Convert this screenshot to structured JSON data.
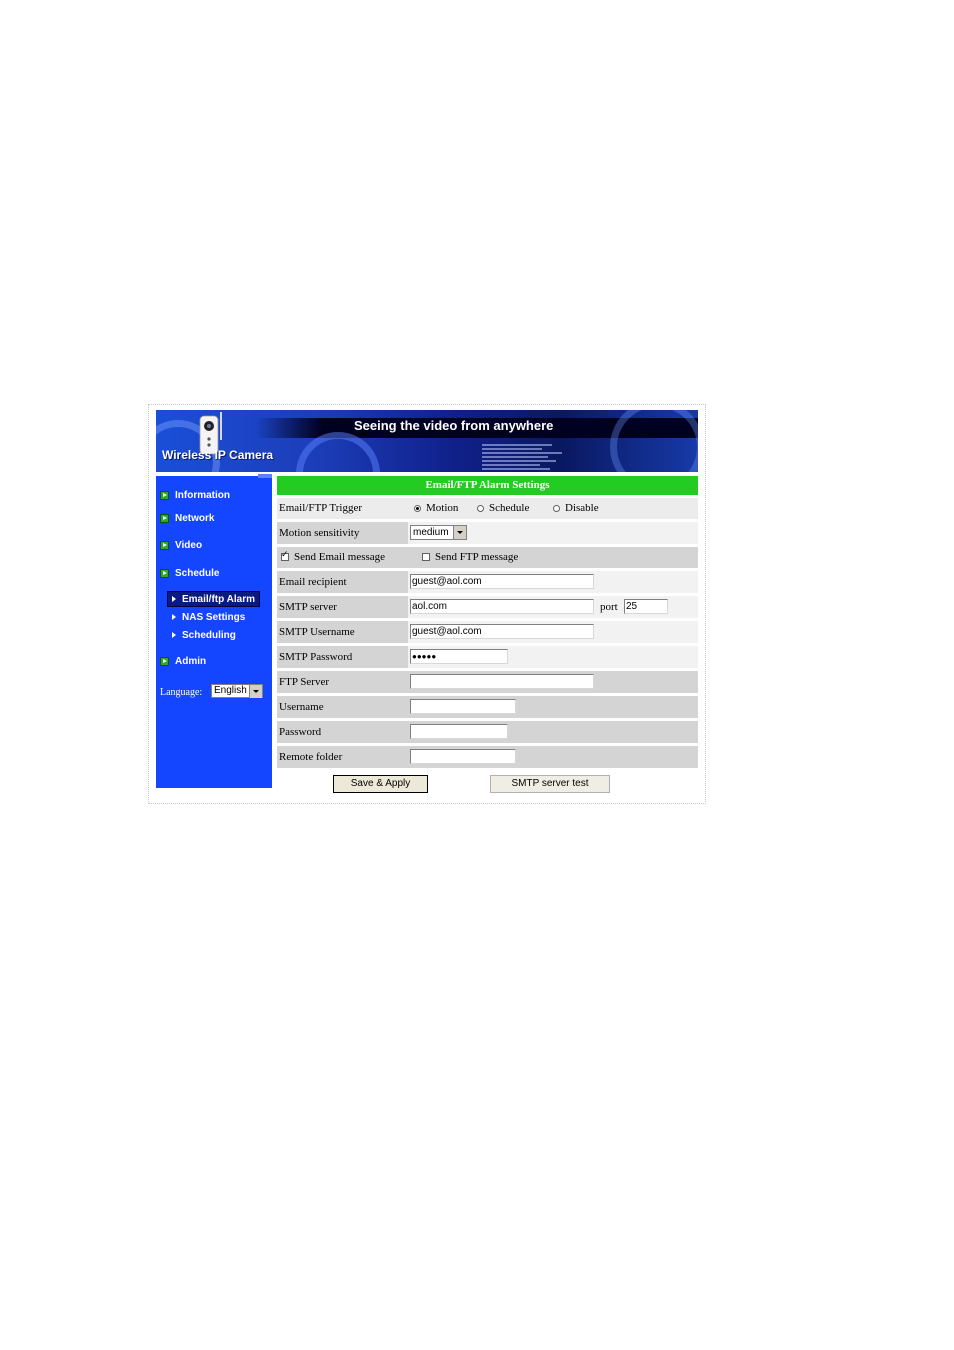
{
  "banner": {
    "title": "Wireless IP Camera",
    "slogan": "Seeing the video from anywhere"
  },
  "sidebar": {
    "items": [
      {
        "label": "Information"
      },
      {
        "label": "Network"
      },
      {
        "label": "Video"
      },
      {
        "label": "Schedule"
      },
      {
        "label": "Admin"
      }
    ],
    "subitems": [
      {
        "label": "Email/ftp Alarm",
        "active": true
      },
      {
        "label": "NAS Settings"
      },
      {
        "label": "Scheduling"
      }
    ],
    "language": {
      "label": "Language:",
      "value": "English"
    }
  },
  "form": {
    "header": "Email/FTP Alarm Settings",
    "trigger": {
      "label": "Email/FTP Trigger",
      "options": [
        "Motion",
        "Schedule",
        "Disable"
      ],
      "selected": "Motion"
    },
    "motion_sensitivity": {
      "label": "Motion sensitivity",
      "value": "medium"
    },
    "send_email": {
      "label": "Send Email message",
      "checked": true
    },
    "send_ftp": {
      "label": "Send FTP message",
      "checked": false
    },
    "email_recipient": {
      "label": "Email recipient",
      "value": "guest@aol.com"
    },
    "smtp_server": {
      "label": "SMTP server",
      "value": "aol.com",
      "port_label": "port",
      "port_value": "25"
    },
    "smtp_username": {
      "label": "SMTP Username",
      "value": "guest@aol.com"
    },
    "smtp_password": {
      "label": "SMTP Password",
      "value": "●●●●●"
    },
    "ftp_server": {
      "label": "FTP Server",
      "value": ""
    },
    "username": {
      "label": "Username",
      "value": ""
    },
    "password": {
      "label": "Password",
      "value": ""
    },
    "remote_folder": {
      "label": "Remote folder",
      "value": ""
    }
  },
  "buttons": {
    "save": "Save & Apply",
    "smtp_test": "SMTP server test"
  },
  "colors": {
    "sidebar": "#1446ff",
    "header_green": "#22cc22",
    "row_gray": "#d4d4d4"
  }
}
